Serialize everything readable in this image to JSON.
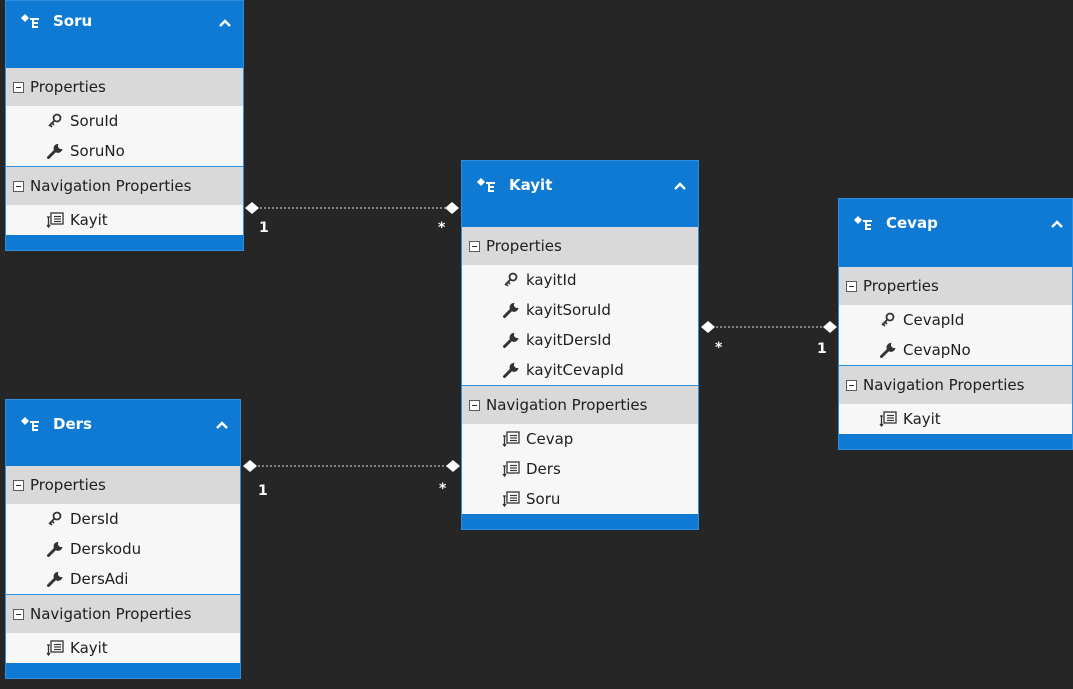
{
  "entities": {
    "soru": {
      "name": "Soru",
      "sections": {
        "properties": "Properties",
        "navigation": "Navigation Properties"
      },
      "properties": [
        {
          "name": "SoruId",
          "icon": "key-icon"
        },
        {
          "name": "SoruNo",
          "icon": "wrench-icon"
        }
      ],
      "navigation": [
        {
          "name": "Kayit",
          "icon": "navigation-property-icon"
        }
      ]
    },
    "kayit": {
      "name": "Kayit",
      "sections": {
        "properties": "Properties",
        "navigation": "Navigation Properties"
      },
      "properties": [
        {
          "name": "kayitId",
          "icon": "key-icon"
        },
        {
          "name": "kayitSoruId",
          "icon": "wrench-icon"
        },
        {
          "name": "kayitDersId",
          "icon": "wrench-icon"
        },
        {
          "name": "kayitCevapId",
          "icon": "wrench-icon"
        }
      ],
      "navigation": [
        {
          "name": "Cevap",
          "icon": "navigation-property-icon"
        },
        {
          "name": "Ders",
          "icon": "navigation-property-icon"
        },
        {
          "name": "Soru",
          "icon": "navigation-property-icon"
        }
      ]
    },
    "ders": {
      "name": "Ders",
      "sections": {
        "properties": "Properties",
        "navigation": "Navigation Properties"
      },
      "properties": [
        {
          "name": "DersId",
          "icon": "key-icon"
        },
        {
          "name": "Derskodu",
          "icon": "wrench-icon"
        },
        {
          "name": "DersAdi",
          "icon": "wrench-icon"
        }
      ],
      "navigation": [
        {
          "name": "Kayit",
          "icon": "navigation-property-icon"
        }
      ]
    },
    "cevap": {
      "name": "Cevap",
      "sections": {
        "properties": "Properties",
        "navigation": "Navigation Properties"
      },
      "properties": [
        {
          "name": "CevapId",
          "icon": "key-icon"
        },
        {
          "name": "CevapNo",
          "icon": "wrench-icon"
        }
      ],
      "navigation": [
        {
          "name": "Kayit",
          "icon": "navigation-property-icon"
        }
      ]
    }
  },
  "associations": [
    {
      "from": "Soru",
      "to": "Kayit",
      "from_multiplicity": "1",
      "to_multiplicity": "*"
    },
    {
      "from": "Ders",
      "to": "Kayit",
      "from_multiplicity": "1",
      "to_multiplicity": "*"
    },
    {
      "from": "Kayit",
      "to": "Cevap",
      "from_multiplicity": "*",
      "to_multiplicity": "1"
    }
  ],
  "colors": {
    "canvas": "#262626",
    "entity_header": "#0e7ad3",
    "section_header": "#d9d9d9",
    "row_background": "#f7f7f7",
    "connector": "#cfcfcf"
  }
}
